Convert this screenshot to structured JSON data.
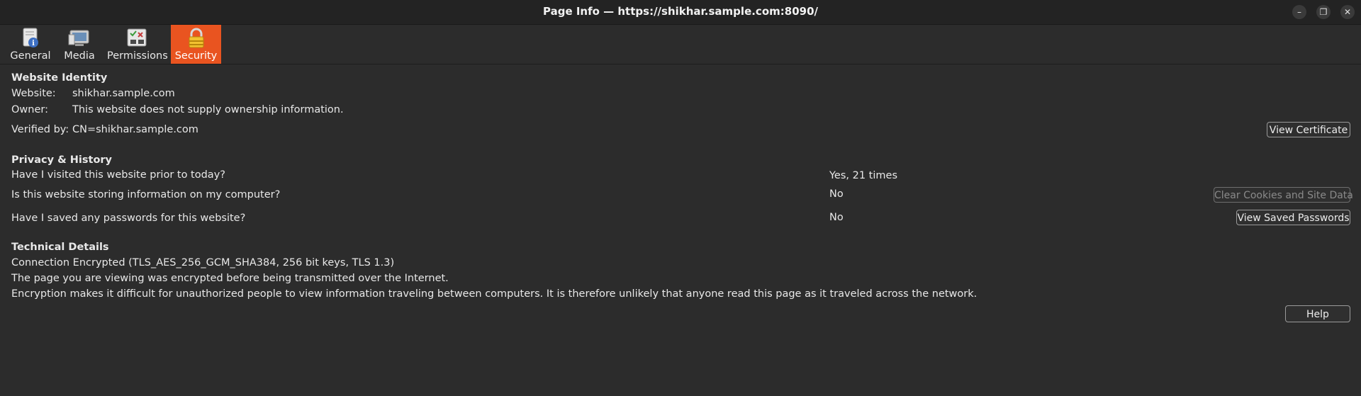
{
  "window": {
    "title": "Page Info — https://shikhar.sample.com:8090/"
  },
  "tabs": [
    {
      "label": "General",
      "icon": "document-info-icon"
    },
    {
      "label": "Media",
      "icon": "media-icon"
    },
    {
      "label": "Permissions",
      "icon": "permissions-icon"
    },
    {
      "label": "Security",
      "icon": "lock-icon",
      "active": true
    }
  ],
  "identity": {
    "heading": "Website Identity",
    "website_label": "Website:",
    "website_value": "shikhar.sample.com",
    "owner_label": "Owner:",
    "owner_value": "This website does not supply ownership information.",
    "verified_label": "Verified by:",
    "verified_value": "CN=shikhar.sample.com",
    "view_certificate": "View Certificate"
  },
  "privacy": {
    "heading": "Privacy & History",
    "visited_q": "Have I visited this website prior to today?",
    "visited_a": "Yes, 21 times",
    "storing_q": "Is this website storing information on my computer?",
    "storing_a": "No",
    "clear_cookies": "Clear Cookies and Site Data",
    "passwords_q": "Have I saved any passwords for this website?",
    "passwords_a": "No",
    "view_passwords": "View Saved Passwords"
  },
  "technical": {
    "heading": "Technical Details",
    "line1": "Connection Encrypted (TLS_AES_256_GCM_SHA384, 256 bit keys, TLS 1.3)",
    "line2": "The page you are viewing was encrypted before being transmitted over the Internet.",
    "line3": "Encryption makes it difficult for unauthorized people to view information traveling between computers. It is therefore unlikely that anyone read this page as it traveled across the network."
  },
  "footer": {
    "help": "Help"
  },
  "colors": {
    "accent": "#e95420",
    "background": "#2c2c2c",
    "titlebar": "#232323"
  }
}
